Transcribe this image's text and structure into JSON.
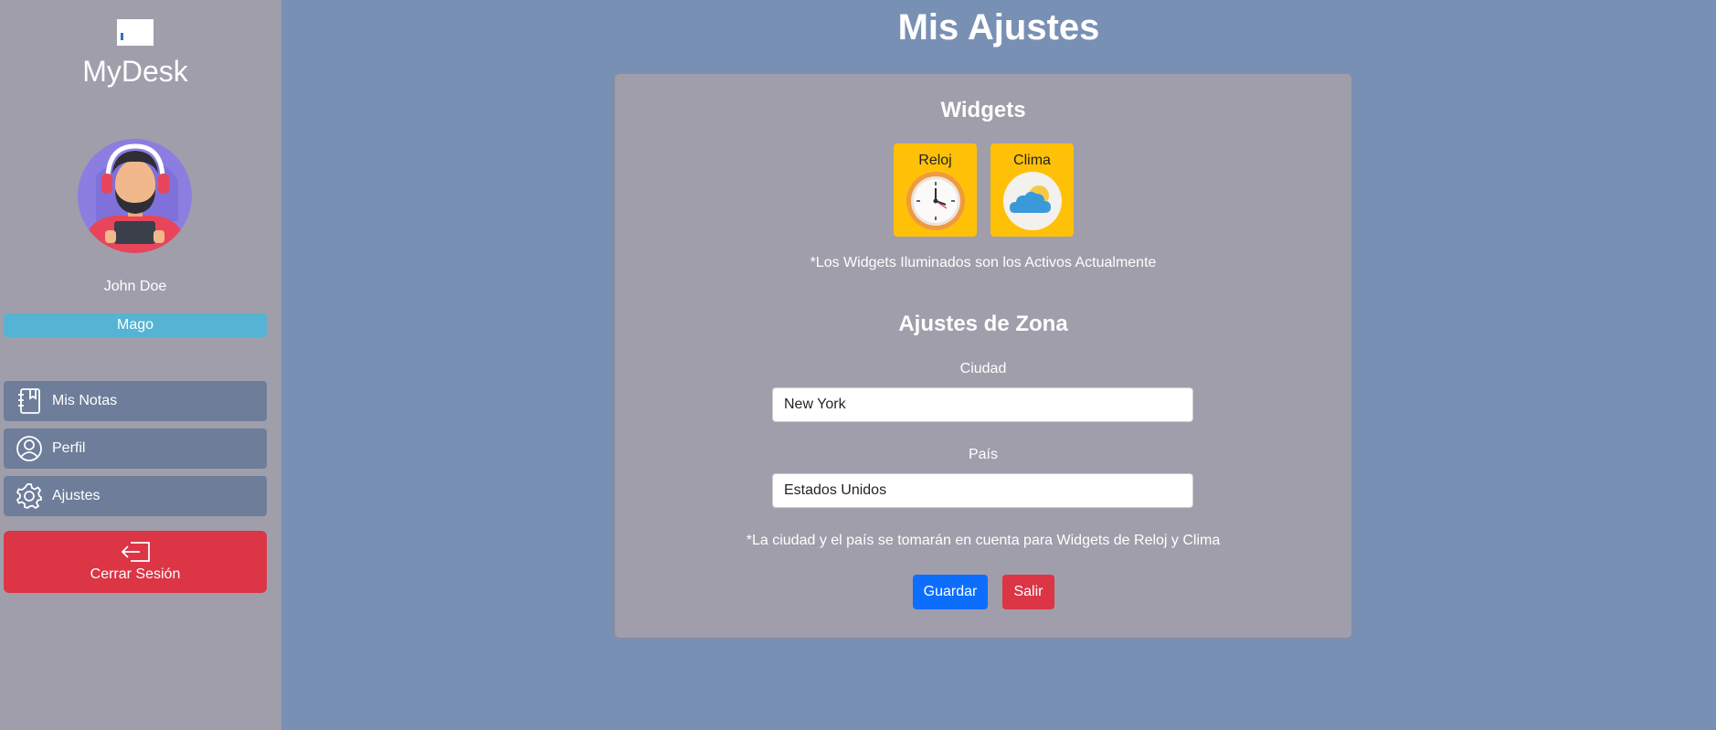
{
  "sidebar": {
    "brand": "MyDesk",
    "username": "John Doe",
    "role": "Mago",
    "nav": [
      {
        "label": "Mis Notas",
        "icon": "notebook-icon"
      },
      {
        "label": "Perfil",
        "icon": "person-icon"
      },
      {
        "label": "Ajustes",
        "icon": "gear-icon"
      }
    ],
    "logout": {
      "label": "Cerrar Sesión",
      "icon": "logout-icon"
    }
  },
  "main": {
    "title": "Mis Ajustes",
    "widgets_title": "Widgets",
    "widgets": [
      {
        "label": "Reloj",
        "icon": "clock-icon",
        "active": true
      },
      {
        "label": "Clima",
        "icon": "weather-icon",
        "active": true
      }
    ],
    "widgets_note": "*Los Widgets Iluminados son los Activos Actualmente",
    "zone_title": "Ajustes de Zona",
    "city_label": "Ciudad",
    "city_value": "New York",
    "country_label": "País",
    "country_value": "Estados Unidos",
    "zone_note": "*La ciudad y el país se tomarán en cuenta para Widgets de Reloj y Clima",
    "save_label": "Guardar",
    "exit_label": "Salir"
  },
  "colors": {
    "background": "#7990b5",
    "sidebar": "#a09eab",
    "badge": "#55b4d3",
    "nav_item": "#6d7d9a",
    "danger": "#dc3545",
    "primary": "#0d6efd",
    "widget_active": "#ffc107"
  }
}
